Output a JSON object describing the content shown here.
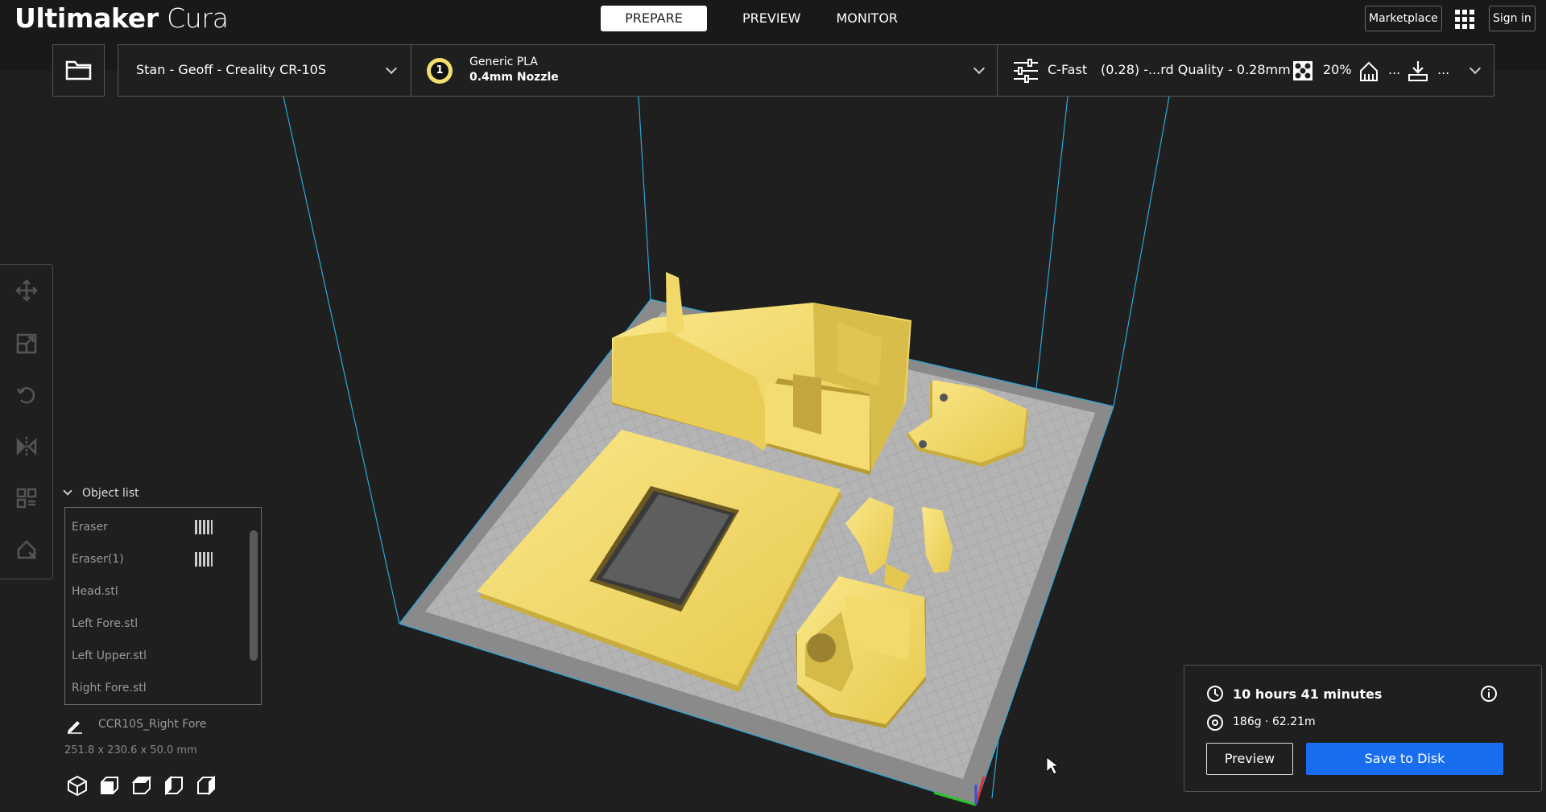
{
  "app": {
    "title_bold": "Ultimaker",
    "title_light": " Cura"
  },
  "stages": [
    {
      "label": "PREPARE",
      "active": true
    },
    {
      "label": "PREVIEW",
      "active": false
    },
    {
      "label": "MONITOR",
      "active": false
    }
  ],
  "header_right": {
    "marketplace": "Marketplace",
    "sign_in": "Sign in"
  },
  "printer": {
    "name": "Stan - Geoff  - Creality CR-10S"
  },
  "extruder": {
    "number": "1",
    "material": "Generic PLA",
    "nozzle": "0.4mm Nozzle"
  },
  "print_settings": {
    "profile": "C-Fast",
    "quality": "(0.28) -...rd Quality - 0.28mm",
    "infill": "20%",
    "support": "...",
    "adhesion": "..."
  },
  "object_list": {
    "title": "Object list",
    "items": [
      {
        "label": "Eraser",
        "badge": true
      },
      {
        "label": "Eraser(1)",
        "badge": true
      },
      {
        "label": "Head.stl",
        "badge": false
      },
      {
        "label": "Left Fore.stl",
        "badge": false
      },
      {
        "label": "Left Upper.stl",
        "badge": false
      },
      {
        "label": "Right Fore.stl",
        "badge": false
      }
    ]
  },
  "selection": {
    "name": "CCR10S_Right Fore",
    "dimensions": "251.8 x 230.6 x 50.0 mm"
  },
  "print_info": {
    "time": "10 hours 41 minutes",
    "material_usage": "186g · 62.21m",
    "preview_label": "Preview",
    "save_label": "Save to Disk"
  },
  "colors": {
    "model": "#f5df6b",
    "accent_blue": "#196ef0",
    "build_volume_line": "#2ca8d8",
    "plate": "#b8b8b8"
  },
  "icons": [
    "folder-icon",
    "extruder-icon",
    "settings-sliders-icon",
    "infill-icon",
    "support-icon",
    "adhesion-icon",
    "move-icon",
    "scale-icon",
    "rotate-icon",
    "mirror-icon",
    "per-model-settings-icon",
    "support-blocker-icon",
    "clock-icon",
    "spool-icon",
    "info-icon",
    "edit-icon",
    "view-3d-icon",
    "view-front-icon",
    "view-top-icon",
    "view-left-icon",
    "view-right-icon"
  ]
}
